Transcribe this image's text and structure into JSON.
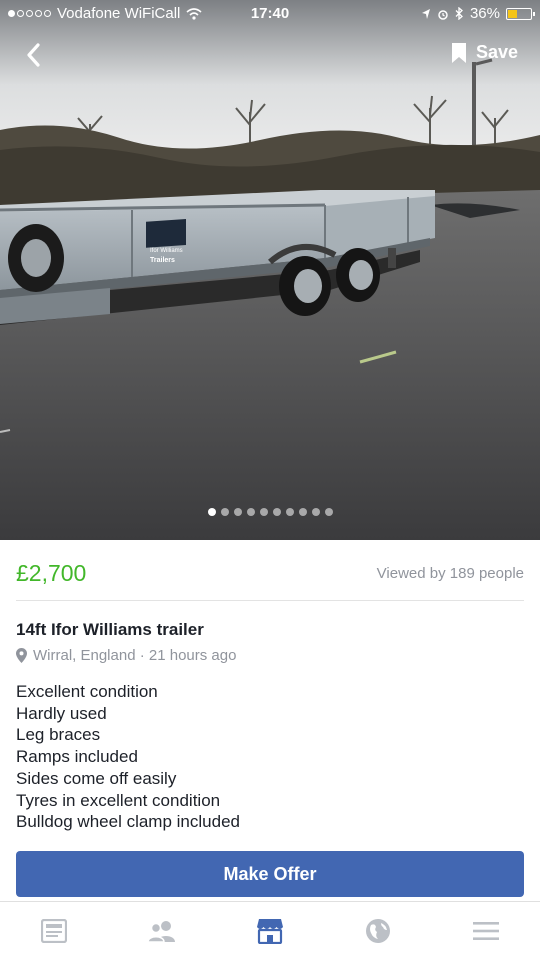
{
  "status_bar": {
    "carrier": "Vodafone WiFiCall",
    "time": "17:40",
    "battery": "36%"
  },
  "header": {
    "save_label": "Save"
  },
  "photo": {
    "total": 10,
    "current": 1,
    "trailer_brand_lines": [
      "Ifor Williams",
      "Trailers"
    ]
  },
  "listing": {
    "price": "£2,700",
    "views": "Viewed by 189 people",
    "title": "14ft Ifor Williams trailer",
    "location": "Wirral, England · 21 hours ago",
    "description": [
      "Excellent condition",
      "Hardly used",
      "Leg braces",
      "Ramps included",
      "Sides come off easily",
      "Tyres in excellent condition",
      "Bulldog wheel clamp included"
    ]
  },
  "actions": {
    "make_offer": "Make Offer"
  },
  "tabbar": {
    "tabs": [
      {
        "icon": "news-feed-icon",
        "active": false
      },
      {
        "icon": "friends-icon",
        "active": false
      },
      {
        "icon": "marketplace-icon",
        "active": true
      },
      {
        "icon": "globe-icon",
        "active": false
      },
      {
        "icon": "menu-icon",
        "active": false
      }
    ]
  },
  "colors": {
    "price": "#42b72a",
    "button": "#4267b2",
    "active_tab": "#4267b2",
    "inactive_tab": "#bcc0c6"
  }
}
